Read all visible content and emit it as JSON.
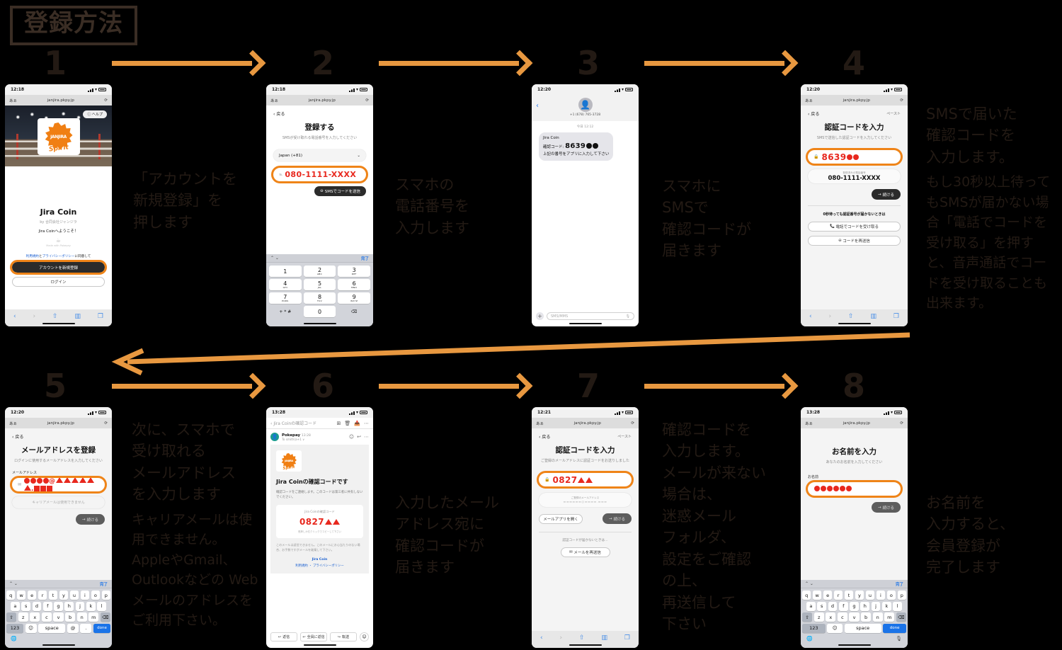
{
  "title": "登録方法",
  "steps": [
    "1",
    "2",
    "3",
    "4",
    "5",
    "6",
    "7",
    "8"
  ],
  "annotations": [
    {
      "lead_html": "「アカウントを\n新規登録」を\n押します",
      "sub": ""
    },
    {
      "lead_html": "スマホの\n電話番号を\n入力します",
      "sub": ""
    },
    {
      "lead_html": "スマホに\nSMSで\n確認コードが\n届きます",
      "sub": ""
    },
    {
      "lead_html": "SMSで届いた\n確認コードを\n入力します。",
      "sub": "もし30秒以上待ってもSMSが届かない場合「電話でコードを受け取る」を押すと、音声通話でコードを受け取ることも出来ます。"
    },
    {
      "lead_html": "次に、スマホで\n受け取れる\nメールアドレス\nを入力します",
      "sub": "キャリアメールは使用できません。AppleやGmail、Outlookなどの Webメールのアドレスをご利用下さい。"
    },
    {
      "lead_html": "入力したメール\nアドレス宛に\n確認コードが\n届きます",
      "sub": ""
    },
    {
      "lead_html": "確認コードを\n入力します。\nメールが来ない\n場合は、\n迷惑メール\nフォルダ、\n設定をご確認\nの上、\n再送信して\n下さい",
      "sub": ""
    },
    {
      "lead_html": "お名前を\n入力すると、\n会員登録が\n完了します",
      "sub": ""
    }
  ],
  "colors": {
    "accent_orange": "#e89840",
    "highlight_orange": "#ef8418",
    "ink": "#231a14",
    "red": "#e8281e"
  },
  "phone1": {
    "status_time": "12:18",
    "url": "janjira.pkpy.jp",
    "aa": "あぁ",
    "help": "ヘルプ",
    "brand": "Jira Coin",
    "logo_text": "JANJIRA",
    "logo_sub": "Spirit",
    "by": "by 合同会社ジャンジラ",
    "welcome": "Jira Coinへようこそ！",
    "made_with": "Made with Pokepay",
    "terms_line_a": "利用規約",
    "terms_line_b": "と",
    "terms_line_c": "プライバシーポリシー",
    "terms_line_d": "に同意して",
    "primary_btn": "アカウントを新規登録",
    "secondary_btn": "ログイン"
  },
  "phone2": {
    "status_time": "12:18",
    "url": "janjira.pkpy.jp",
    "aa": "あぁ",
    "back": "戻る",
    "title": "登録する",
    "subtitle": "SMSが受け取れる電話番号を入力してください",
    "country": "Japan (+81)",
    "phone_value": "080-1111-XXXX",
    "send_btn": "SMSでコードを送信",
    "kb_done": "完了",
    "keys": [
      {
        "n": "1",
        "s": ""
      },
      {
        "n": "2",
        "s": "ABC"
      },
      {
        "n": "3",
        "s": "DEF"
      },
      {
        "n": "4",
        "s": "GHI"
      },
      {
        "n": "5",
        "s": "JKL"
      },
      {
        "n": "6",
        "s": "MNO"
      },
      {
        "n": "7",
        "s": "PQRS"
      },
      {
        "n": "8",
        "s": "TUV"
      },
      {
        "n": "9",
        "s": "WXYZ"
      },
      {
        "n": "+ * #",
        "s": ""
      },
      {
        "n": "0",
        "s": ""
      },
      {
        "n": "⌫",
        "s": ""
      }
    ]
  },
  "phone3": {
    "status_time": "12:20",
    "contact": "+1 (678) 765-3728",
    "day_time": "今日 12:12",
    "msg_line1": "Jira Coin",
    "msg_label": "確認コード:",
    "msg_code": "8639",
    "msg_line3": "上記の番号をアプリに入力して下さい",
    "input_placeholder": "SMS/MMS"
  },
  "phone4": {
    "status_time": "12:20",
    "url": "janjira.pkpy.jp",
    "aa": "あぁ",
    "back": "戻る",
    "paste": "ペースト",
    "title": "認証コードを入力",
    "subtitle": "SMSで送信した認証コードを入力してください",
    "code_value": "8639",
    "registered_label": "登録済みの電話番号",
    "registered_number": "080-1111-XXXX",
    "continue_btn": "続ける",
    "wait_note": "0秒待っても認証番号が届かないときは",
    "call_btn": "電話でコードを受け取る",
    "resend_btn": "コードを再送信"
  },
  "phone5": {
    "status_time": "12:20",
    "url": "janjira.pkpy.jp",
    "aa": "あぁ",
    "back": "戻る",
    "title": "メールアドレスを登録",
    "subtitle": "ログインに使用するメールアドレスを入力してください",
    "field_label": "メールアドレス",
    "hint": "キャリアメールは使用できません",
    "continue_btn": "続ける",
    "kb_done": "完了",
    "row1": [
      "q",
      "w",
      "e",
      "r",
      "t",
      "y",
      "u",
      "i",
      "o",
      "p"
    ],
    "row2": [
      "a",
      "s",
      "d",
      "f",
      "g",
      "h",
      "j",
      "k",
      "l"
    ],
    "row3": [
      "⇧",
      "z",
      "x",
      "c",
      "v",
      "b",
      "n",
      "m",
      "⌫"
    ],
    "row4": [
      "123",
      "☺",
      "space",
      "@",
      ".",
      "done"
    ]
  },
  "phone6": {
    "status_time": "13:28",
    "mail_subject": "Jira Coinの確認コード",
    "sender": "Pokepay",
    "sender_time": "13:28",
    "to": "To smith(a+1 ∨",
    "heading": "Jira Coinの確認コードです",
    "body": "確認コードをご連絡します。このコードは第三者に共有しないでください。",
    "card_label": "Jira Coinの確認コード",
    "card_code": "0827",
    "card_note": "長押しか右クリックでコピーして下さい",
    "footer": "このメールは返信できません。このメールにお心当たりのない場合、お手数ですがメールを破棄して下さい。",
    "brand": "Jira Coin",
    "links": "利用規約 ・ プライバシーポリシー",
    "actions": [
      "返信",
      "全員に返信",
      "転送"
    ]
  },
  "phone7": {
    "status_time": "12:21",
    "url": "janjira.pkpy.jp",
    "aa": "あぁ",
    "back": "戻る",
    "paste": "ペースト",
    "title": "認証コードを入力",
    "subtitle": "ご登録のメールアドレスに認証コードをお送りしました",
    "code_value": "0827",
    "email_label": "ご登録のメールアドレス",
    "open_mail_btn": "メールアプリを開く",
    "continue_btn": "続ける",
    "not_arrive": "認証コードが届かないときは…",
    "resend_btn": "メールを再送信"
  },
  "phone8": {
    "status_time": "13:28",
    "url": "janjira.pkpy.jp",
    "aa": "あぁ",
    "title": "お名前を入力",
    "subtitle": "あなたのお名前を入力してください",
    "field_label": "お名前",
    "continue_btn": "続ける",
    "kb_done": "完了",
    "row1": [
      "q",
      "w",
      "e",
      "r",
      "t",
      "y",
      "u",
      "i",
      "o",
      "p"
    ],
    "row2": [
      "a",
      "s",
      "d",
      "f",
      "g",
      "h",
      "j",
      "k",
      "l"
    ],
    "row3": [
      "⇧",
      "z",
      "x",
      "c",
      "v",
      "b",
      "n",
      "m",
      "⌫"
    ],
    "row4": [
      "123",
      "☺",
      "space",
      "done"
    ]
  }
}
